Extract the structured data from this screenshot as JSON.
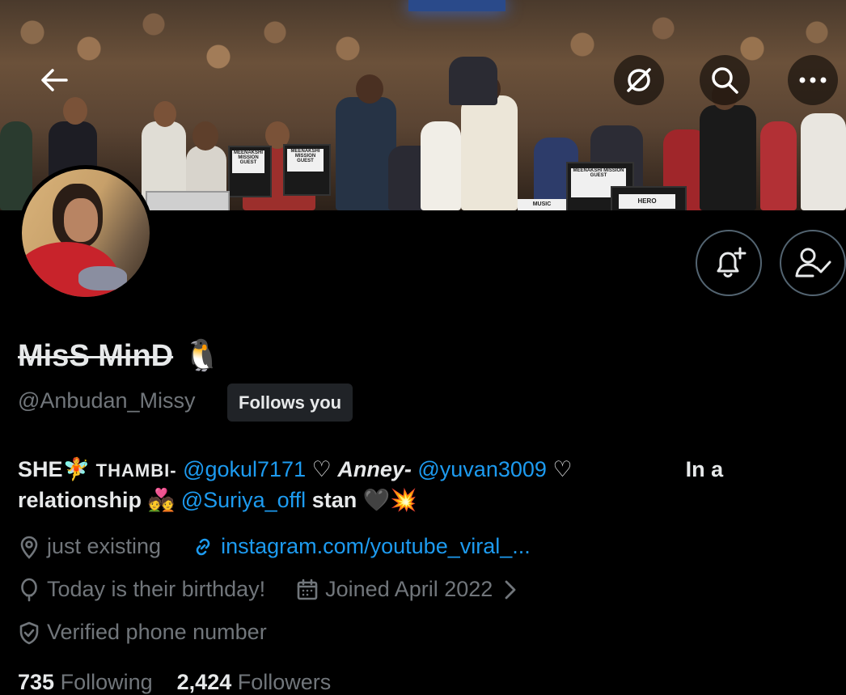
{
  "profile": {
    "display_name": "MisS MinD",
    "name_emoji": "🐧",
    "handle": "@Anbudan_Missy",
    "follows_you_label": "Follows you"
  },
  "bio": {
    "she": "SHE",
    "fairy": "🧚",
    "thambi_label": "THAMBI-",
    "thambi_mention": "@gokul7171",
    "heart1": "♡",
    "anney_label": "Anney-",
    "anney_mention": "@yuvan3009",
    "heart2": "♡",
    "relationship_text": "In a relationship",
    "couple_emoji": "💑",
    "suriya_mention": "@Suriya_offl",
    "stan_text": "stan",
    "black_heart": "🖤",
    "boom": "💥"
  },
  "meta": {
    "location": "just existing",
    "website": "instagram.com/youtube_viral_...",
    "birthday": "Today is their birthday!",
    "joined": "Joined April 2022",
    "verified_phone": "Verified phone number"
  },
  "counts": {
    "following_value": "735",
    "following_label": "Following",
    "followers_value": "2,424",
    "followers_label": "Followers"
  },
  "banner_cards": {
    "card1": "MEENAKSHI MISSION GUEST",
    "card2": "MEENAKSHI MISSION GUEST",
    "card3": "MEENAKSHI MISSION GUEST",
    "hero": "HERO",
    "music": "MUSIC"
  },
  "icons": {
    "back": "arrow-left-icon",
    "no_translate": "slashed-circle-icon",
    "search": "search-icon",
    "more": "ellipsis-icon",
    "notify": "bell-plus-icon",
    "following": "person-check-icon"
  },
  "colors": {
    "accent": "#1d9bf0",
    "muted": "#71767b",
    "text": "#e7e9ea",
    "border": "#536471"
  }
}
